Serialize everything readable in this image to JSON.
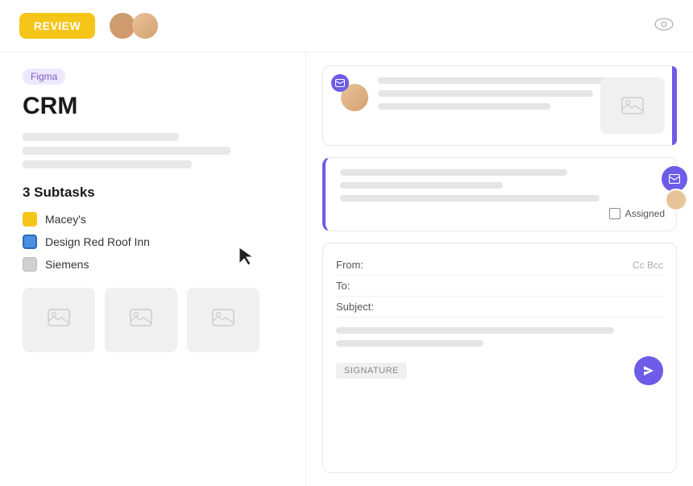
{
  "header": {
    "review_label": "REVIEW",
    "eye_icon": "👁"
  },
  "left": {
    "tag": "Figma",
    "title": "CRM",
    "subtasks_title": "3 Subtasks",
    "subtasks": [
      {
        "id": "maceys",
        "label": "Macey's",
        "icon_type": "yellow"
      },
      {
        "id": "design-red-roof",
        "label": "Design Red Roof Inn",
        "icon_type": "blue"
      },
      {
        "id": "siemens",
        "label": "Siemens",
        "icon_type": "gray"
      }
    ]
  },
  "right": {
    "email_cards": [
      {
        "id": "card-1",
        "active": true
      },
      {
        "id": "card-2",
        "active": true,
        "assigned_label": "Assigned"
      }
    ],
    "compose": {
      "from_label": "From:",
      "to_label": "To:",
      "subject_label": "Subject:",
      "cc_bcc_label": "Cc Bcc",
      "signature_label": "SIGNATURE"
    }
  }
}
